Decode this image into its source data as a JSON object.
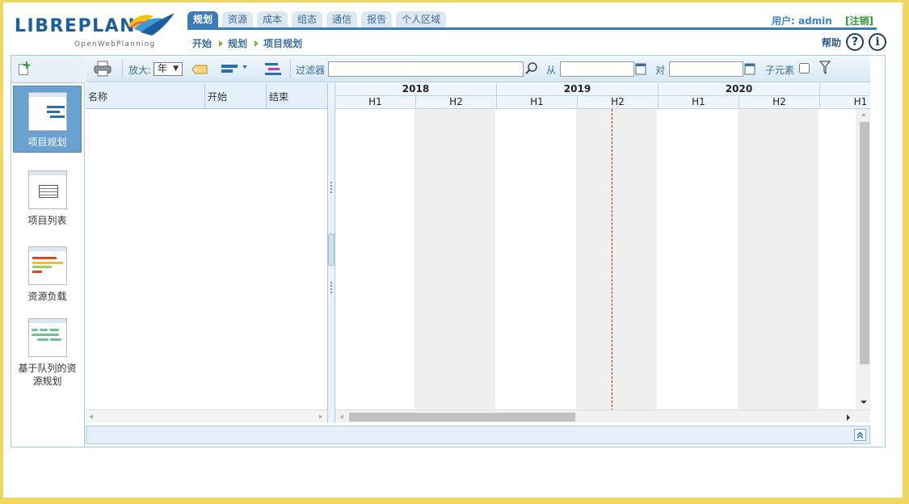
{
  "app": {
    "logo_text": "LIBREPLAN",
    "logo_sub": "OpenWebPlanning",
    "brand_color": "#1a5f9e"
  },
  "tabs": [
    {
      "label": "规划",
      "active": true
    },
    {
      "label": "资源",
      "active": false
    },
    {
      "label": "成本",
      "active": false
    },
    {
      "label": "组态",
      "active": false
    },
    {
      "label": "通信",
      "active": false
    },
    {
      "label": "报告",
      "active": false
    },
    {
      "label": "个人区域",
      "active": false
    }
  ],
  "breadcrumb": [
    "开始",
    "规划",
    "项目规划"
  ],
  "user": {
    "label": "用户:",
    "name": "admin",
    "logout": "[注销]"
  },
  "help": {
    "label": "帮助",
    "icon": "question-icon",
    "info_icon": "info-icon"
  },
  "toolbar": {
    "zoom_label": "放大:",
    "zoom_value": "年",
    "filter_label": "过滤器",
    "filter_value": "",
    "from_label": "从",
    "from_value": "",
    "to_label": "对",
    "to_value": "",
    "subelements_label": "子元素",
    "subelements_checked": false
  },
  "perspectives": [
    {
      "label": "项目规划",
      "active": true,
      "icon": "gantt-icon"
    },
    {
      "label": "项目列表",
      "active": false,
      "icon": "table-icon"
    },
    {
      "label": "资源负载",
      "active": false,
      "icon": "resource-load-icon"
    },
    {
      "label": "基于队列的资源规划",
      "active": false,
      "icon": "queue-planning-icon"
    }
  ],
  "list_columns": [
    "名称",
    "开始",
    "结束"
  ],
  "timeline": {
    "years": [
      "2018",
      "2019",
      "2020"
    ],
    "halves": [
      "H1",
      "H2",
      "H1",
      "H2",
      "H1",
      "H2",
      "H1"
    ]
  },
  "colors": {
    "accent": "#3d7ab8",
    "today_line": "#d01d1d",
    "logout": "#2e9a37"
  }
}
